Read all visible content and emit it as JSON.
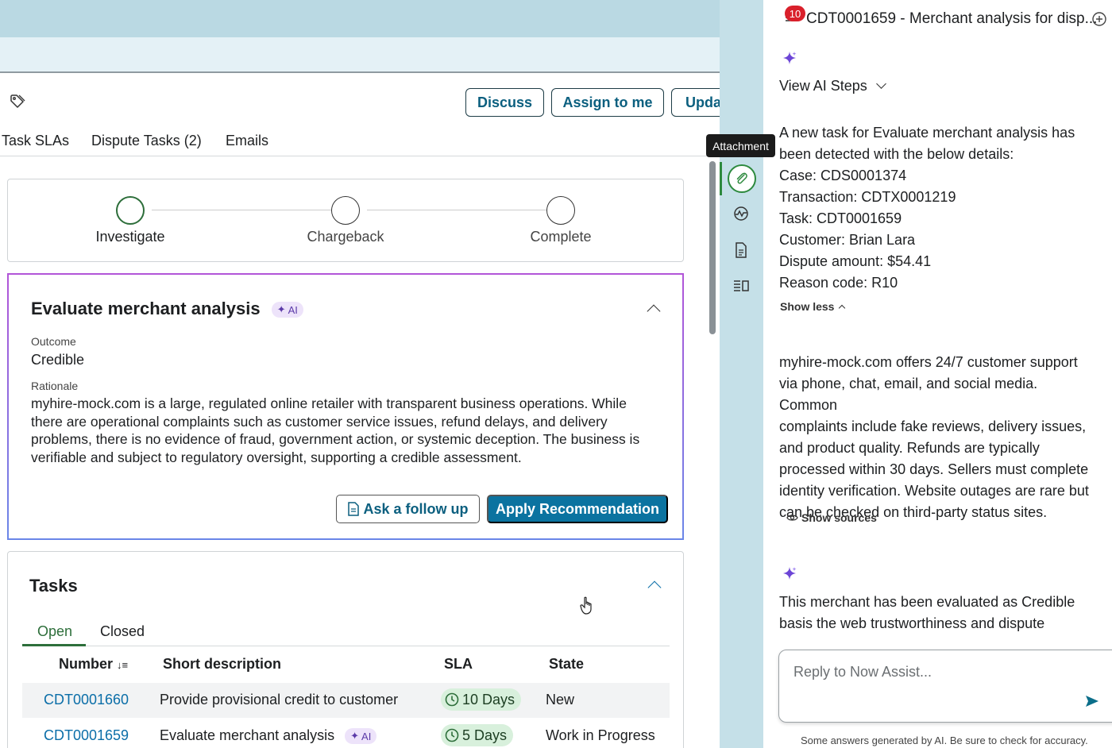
{
  "header": {
    "discuss_label": "Discuss",
    "assign_label": "Assign to me",
    "update_label": "Update"
  },
  "tabs": [
    {
      "label": "Task SLAs"
    },
    {
      "label": "Dispute Tasks (2)"
    },
    {
      "label": "Emails"
    }
  ],
  "stepper": {
    "steps": [
      {
        "label": "Investigate",
        "active": true
      },
      {
        "label": "Chargeback",
        "active": false
      },
      {
        "label": "Complete",
        "active": false
      }
    ]
  },
  "ai_card": {
    "title": "Evaluate merchant analysis",
    "badge": "AI",
    "outcome_label": "Outcome",
    "outcome_value": "Credible",
    "rationale_label": "Rationale",
    "rationale_value": "myhire-mock.com is a large, regulated online retailer with transparent business operations. While there are operational complaints such as customer service issues, refund delays, and delivery problems, there is no evidence of fraud, government action, or systemic deception. The business is verifiable and subject to regulatory oversight, supporting a credible assessment.",
    "follow_up_label": "Ask a follow up",
    "apply_label": "Apply Recommendation"
  },
  "tasks": {
    "title": "Tasks",
    "subtabs": [
      {
        "label": "Open"
      },
      {
        "label": "Closed"
      }
    ],
    "columns": [
      "Number",
      "Short description",
      "SLA",
      "State"
    ],
    "rows": [
      {
        "number": "CDT0001660",
        "description": "Provide provisional credit to customer",
        "ai": "",
        "sla": "10 Days",
        "state": "New"
      },
      {
        "number": "CDT0001659",
        "description": "Evaluate merchant analysis",
        "ai": "AI",
        "sla": "5 Days",
        "state": "Work in Progress"
      }
    ]
  },
  "rail": {
    "tooltip": "Attachment"
  },
  "panel": {
    "badge_count": "10",
    "title": "CDT0001659 - Merchant analysis for disp...",
    "view_steps": "View AI Steps",
    "message1": [
      "A new task for Evaluate merchant analysis has",
      "been detected with the below details:",
      "Case: CDS0001374",
      "Transaction: CDTX0001219",
      "Task: CDT0001659",
      "Customer: Brian Lara",
      "Dispute amount: $54.41",
      "Reason code: R10"
    ],
    "show_less": "Show less",
    "message2": [
      "myhire-mock.com offers 24/7 customer support",
      "via phone, chat, email, and social media. Common",
      "complaints include fake reviews, delivery issues,",
      "and product quality. Refunds are typically",
      "processed within 30 days. Sellers must complete",
      "identity verification. Website outages are rare but",
      "can be checked on third-party status sites."
    ],
    "show_sources": "Show sources",
    "message3": [
      "This merchant has been evaluated as Credible",
      "basis the web trustworthiness and dispute"
    ],
    "reply_placeholder": "Reply to Now Assist...",
    "footer_note": "Some answers generated by AI. Be sure to check for accuracy."
  },
  "colors": {
    "accent_blue": "#0b73a0",
    "link_blue": "#0b6ea8",
    "active_green": "#2d6e3a",
    "ai_purple": "#8b7cf0",
    "badge_red": "#d9202b"
  }
}
